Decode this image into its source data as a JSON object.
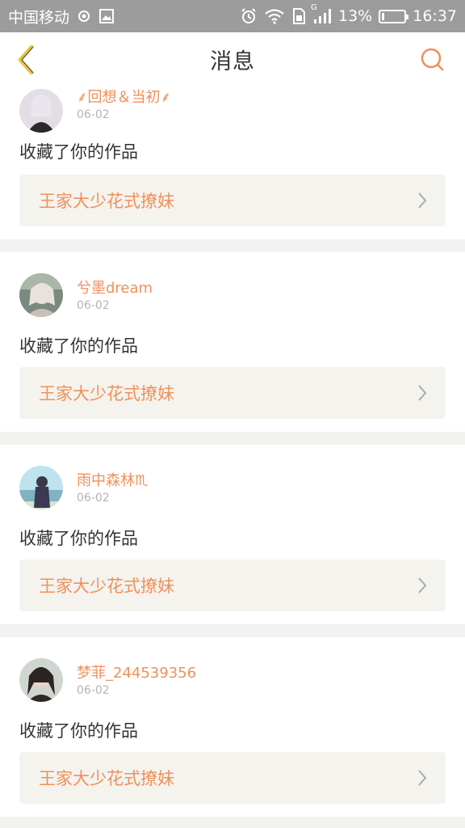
{
  "status_bar": {
    "carrier": "中国移动",
    "network_badge": "G",
    "battery": "13%",
    "time": "16:37",
    "battery_level": 0.13
  },
  "header": {
    "title": "消息",
    "back_icon": "chevron-left-icon",
    "search_icon": "search-icon"
  },
  "colors": {
    "accent": "#f0905a",
    "back_icon": "#e8c43a",
    "work_bg": "#f4f3ee"
  },
  "messages": [
    {
      "username": "⸙回想＆当初⸙",
      "date": "06-02",
      "action": "收藏了你的作品",
      "work_title": "王家大少花式撩妹"
    },
    {
      "username": "兮墨dream",
      "date": "06-02",
      "action": "收藏了你的作品",
      "work_title": "王家大少花式撩妹"
    },
    {
      "username": "雨中森林♏",
      "date": "06-02",
      "action": "收藏了你的作品",
      "work_title": "王家大少花式撩妹"
    },
    {
      "username": "梦菲_244539356",
      "date": "06-02",
      "action": "收藏了你的作品",
      "work_title": "王家大少花式撩妹"
    }
  ]
}
